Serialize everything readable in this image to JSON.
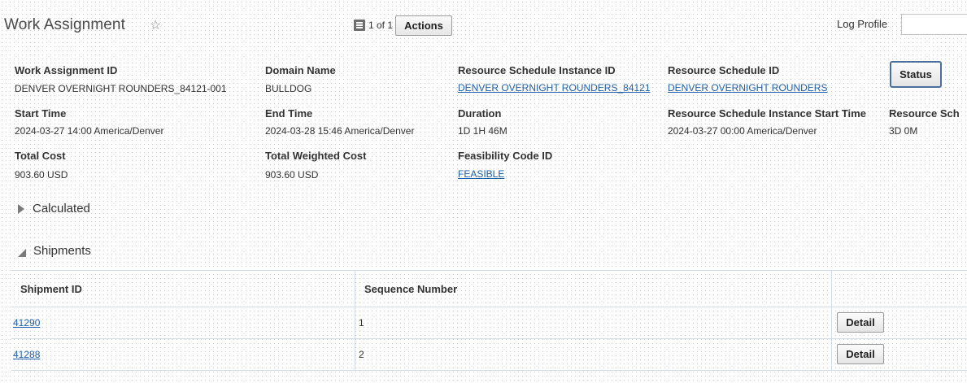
{
  "header": {
    "title": "Work Assignment",
    "record_counter": "1 of 1",
    "actions_label": "Actions",
    "log_profile_label": "Log Profile",
    "log_profile_value": ""
  },
  "details": {
    "work_assignment_id": {
      "label": "Work Assignment ID",
      "value": "DENVER OVERNIGHT ROUNDERS_84121-001"
    },
    "domain_name": {
      "label": "Domain Name",
      "value": "BULLDOG"
    },
    "resource_schedule_instance_id": {
      "label": "Resource Schedule Instance ID",
      "value": "DENVER OVERNIGHT ROUNDERS_84121"
    },
    "resource_schedule_id": {
      "label": "Resource Schedule ID",
      "value": "DENVER OVERNIGHT ROUNDERS"
    },
    "start_time": {
      "label": "Start Time",
      "value": "2024-03-27 14:00 America/Denver"
    },
    "end_time": {
      "label": "End Time",
      "value": "2024-03-28 15:46 America/Denver"
    },
    "duration": {
      "label": "Duration",
      "value": "1D 1H 46M"
    },
    "rsi_start_time": {
      "label": "Resource Schedule Instance Start Time",
      "value": "2024-03-27 00:00 America/Denver"
    },
    "resource_sch": {
      "label": "Resource Sch",
      "value": "3D 0M"
    },
    "total_cost": {
      "label": "Total Cost",
      "value": "903.60 USD"
    },
    "total_weighted_cost": {
      "label": "Total Weighted Cost",
      "value": "903.60 USD"
    },
    "feasibility_code_id": {
      "label": "Feasibility Code ID",
      "value": "FEASIBLE"
    }
  },
  "status_label": "Status",
  "sections": {
    "calculated": "Calculated",
    "shipments": "Shipments"
  },
  "shipments_table": {
    "columns": [
      "Shipment ID",
      "Sequence Number",
      ""
    ],
    "rows": [
      {
        "shipment_id": "41290",
        "sequence_number": "1",
        "action": "Detail"
      },
      {
        "shipment_id": "41288",
        "sequence_number": "2",
        "action": "Detail"
      }
    ]
  },
  "colors": {
    "link": "#1f5fa8",
    "status_border": "#4a6f9c"
  }
}
